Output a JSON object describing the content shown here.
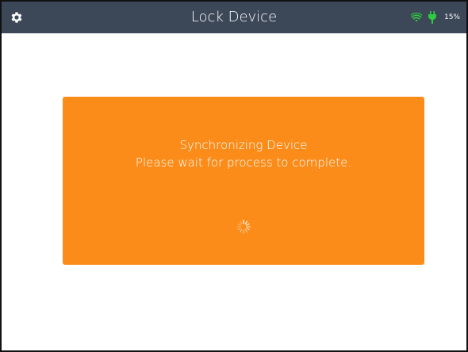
{
  "header": {
    "settings_icon": "gear-icon",
    "title": "Lock Device",
    "status": {
      "wifi_icon": "wifi-icon",
      "power_icon": "plug-icon",
      "battery_label": "15%",
      "accent_color": "#2ecc40"
    }
  },
  "dialog": {
    "line1": "Synchronizing Device",
    "line2": "Please wait for process to complete.",
    "spinner_icon": "loading-spinner-icon",
    "background_color": "#fb8c19"
  },
  "colors": {
    "header_bg": "#3c4758",
    "text": "#ffffff"
  }
}
